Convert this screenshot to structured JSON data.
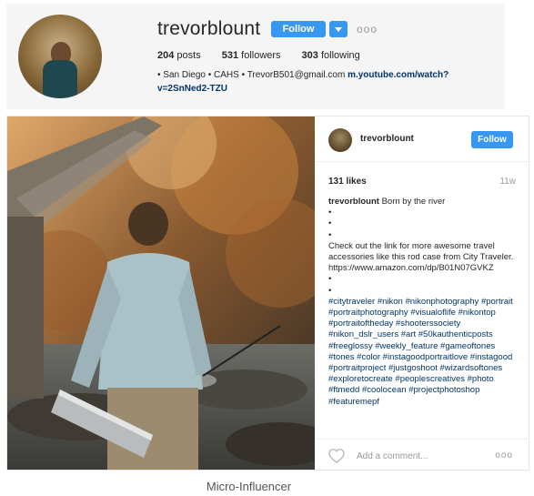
{
  "profile": {
    "username": "trevorblount",
    "follow_label": "Follow",
    "more_label": "ooo",
    "posts_count": "204",
    "posts_label": "posts",
    "followers_count": "531",
    "followers_label": "followers",
    "following_count": "303",
    "following_label": "following",
    "bio_text": "• San Diego • CAHS • TrevorB501@gmail.com",
    "bio_link": "m.youtube.com/watch?v=2SnNed2-TZU"
  },
  "post": {
    "username": "trevorblount",
    "follow_label": "Follow",
    "likes": "131 likes",
    "time": "11w",
    "caption_user": "trevorblount",
    "caption_first": "Born by the river",
    "bullets": [
      "•",
      "•",
      "•"
    ],
    "caption_body": "Check out the link for more awesome travel accessories like this rod case from City Traveler.",
    "caption_url": "https://www.amazon.com/dp/B01N07GVKZ",
    "bullets2": [
      "•",
      "•"
    ],
    "hashtags": "#citytraveler #nikon #nikonphotography #portrait #portraitphotography #visualoflife #nikontop #portraitoftheday #shooterssociety #nikon_dslr_users #art #50kauthenticposts #freeglossy #weekly_feature #gameoftones #tones #color #instagoodportraitlove #instagood #portraitproject #justgoshoot #wizardsoftones #exploretocreate #peoplescreatives #photo #ftmedd #coolocean #projectphotoshop #featuremepf",
    "comment_placeholder": "Add a comment...",
    "more_label": "ooo"
  },
  "figure_caption": "Micro-Influencer",
  "colors": {
    "accent": "#3897f0",
    "link": "#003569",
    "muted": "#999999"
  }
}
